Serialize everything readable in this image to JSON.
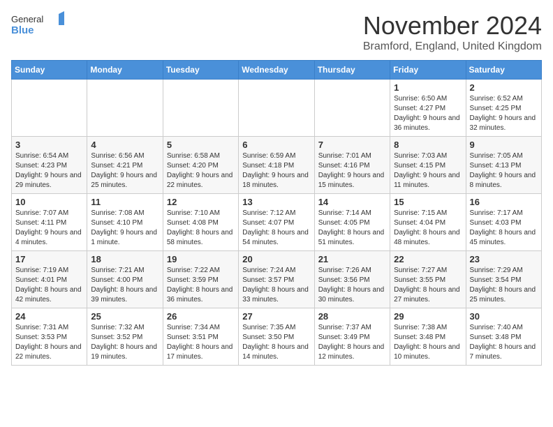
{
  "logo": {
    "general": "General",
    "blue": "Blue"
  },
  "title": "November 2024",
  "location": "Bramford, England, United Kingdom",
  "days_of_week": [
    "Sunday",
    "Monday",
    "Tuesday",
    "Wednesday",
    "Thursday",
    "Friday",
    "Saturday"
  ],
  "weeks": [
    [
      {
        "day": "",
        "info": ""
      },
      {
        "day": "",
        "info": ""
      },
      {
        "day": "",
        "info": ""
      },
      {
        "day": "",
        "info": ""
      },
      {
        "day": "",
        "info": ""
      },
      {
        "day": "1",
        "info": "Sunrise: 6:50 AM\nSunset: 4:27 PM\nDaylight: 9 hours and 36 minutes."
      },
      {
        "day": "2",
        "info": "Sunrise: 6:52 AM\nSunset: 4:25 PM\nDaylight: 9 hours and 32 minutes."
      }
    ],
    [
      {
        "day": "3",
        "info": "Sunrise: 6:54 AM\nSunset: 4:23 PM\nDaylight: 9 hours and 29 minutes."
      },
      {
        "day": "4",
        "info": "Sunrise: 6:56 AM\nSunset: 4:21 PM\nDaylight: 9 hours and 25 minutes."
      },
      {
        "day": "5",
        "info": "Sunrise: 6:58 AM\nSunset: 4:20 PM\nDaylight: 9 hours and 22 minutes."
      },
      {
        "day": "6",
        "info": "Sunrise: 6:59 AM\nSunset: 4:18 PM\nDaylight: 9 hours and 18 minutes."
      },
      {
        "day": "7",
        "info": "Sunrise: 7:01 AM\nSunset: 4:16 PM\nDaylight: 9 hours and 15 minutes."
      },
      {
        "day": "8",
        "info": "Sunrise: 7:03 AM\nSunset: 4:15 PM\nDaylight: 9 hours and 11 minutes."
      },
      {
        "day": "9",
        "info": "Sunrise: 7:05 AM\nSunset: 4:13 PM\nDaylight: 9 hours and 8 minutes."
      }
    ],
    [
      {
        "day": "10",
        "info": "Sunrise: 7:07 AM\nSunset: 4:11 PM\nDaylight: 9 hours and 4 minutes."
      },
      {
        "day": "11",
        "info": "Sunrise: 7:08 AM\nSunset: 4:10 PM\nDaylight: 9 hours and 1 minute."
      },
      {
        "day": "12",
        "info": "Sunrise: 7:10 AM\nSunset: 4:08 PM\nDaylight: 8 hours and 58 minutes."
      },
      {
        "day": "13",
        "info": "Sunrise: 7:12 AM\nSunset: 4:07 PM\nDaylight: 8 hours and 54 minutes."
      },
      {
        "day": "14",
        "info": "Sunrise: 7:14 AM\nSunset: 4:05 PM\nDaylight: 8 hours and 51 minutes."
      },
      {
        "day": "15",
        "info": "Sunrise: 7:15 AM\nSunset: 4:04 PM\nDaylight: 8 hours and 48 minutes."
      },
      {
        "day": "16",
        "info": "Sunrise: 7:17 AM\nSunset: 4:03 PM\nDaylight: 8 hours and 45 minutes."
      }
    ],
    [
      {
        "day": "17",
        "info": "Sunrise: 7:19 AM\nSunset: 4:01 PM\nDaylight: 8 hours and 42 minutes."
      },
      {
        "day": "18",
        "info": "Sunrise: 7:21 AM\nSunset: 4:00 PM\nDaylight: 8 hours and 39 minutes."
      },
      {
        "day": "19",
        "info": "Sunrise: 7:22 AM\nSunset: 3:59 PM\nDaylight: 8 hours and 36 minutes."
      },
      {
        "day": "20",
        "info": "Sunrise: 7:24 AM\nSunset: 3:57 PM\nDaylight: 8 hours and 33 minutes."
      },
      {
        "day": "21",
        "info": "Sunrise: 7:26 AM\nSunset: 3:56 PM\nDaylight: 8 hours and 30 minutes."
      },
      {
        "day": "22",
        "info": "Sunrise: 7:27 AM\nSunset: 3:55 PM\nDaylight: 8 hours and 27 minutes."
      },
      {
        "day": "23",
        "info": "Sunrise: 7:29 AM\nSunset: 3:54 PM\nDaylight: 8 hours and 25 minutes."
      }
    ],
    [
      {
        "day": "24",
        "info": "Sunrise: 7:31 AM\nSunset: 3:53 PM\nDaylight: 8 hours and 22 minutes."
      },
      {
        "day": "25",
        "info": "Sunrise: 7:32 AM\nSunset: 3:52 PM\nDaylight: 8 hours and 19 minutes."
      },
      {
        "day": "26",
        "info": "Sunrise: 7:34 AM\nSunset: 3:51 PM\nDaylight: 8 hours and 17 minutes."
      },
      {
        "day": "27",
        "info": "Sunrise: 7:35 AM\nSunset: 3:50 PM\nDaylight: 8 hours and 14 minutes."
      },
      {
        "day": "28",
        "info": "Sunrise: 7:37 AM\nSunset: 3:49 PM\nDaylight: 8 hours and 12 minutes."
      },
      {
        "day": "29",
        "info": "Sunrise: 7:38 AM\nSunset: 3:48 PM\nDaylight: 8 hours and 10 minutes."
      },
      {
        "day": "30",
        "info": "Sunrise: 7:40 AM\nSunset: 3:48 PM\nDaylight: 8 hours and 7 minutes."
      }
    ]
  ]
}
